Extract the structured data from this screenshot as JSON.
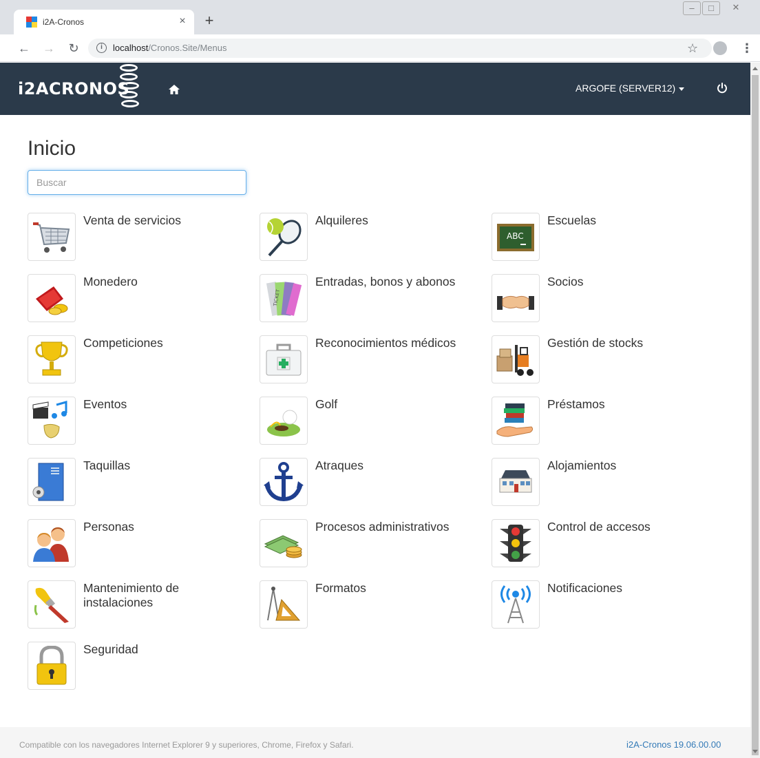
{
  "browser": {
    "tab_title": "i2A-Cronos",
    "tab_close": "×",
    "new_tab": "+",
    "url_host": "localhost",
    "url_path": "/Cronos.Site/Menus"
  },
  "header": {
    "logo_text": "i2ACRONOS",
    "user_label": "ARGOFE (SERVER12)",
    "colors": {
      "header_bg": "#2b3a4a",
      "accent": "#337ab7"
    }
  },
  "page": {
    "title": "Inicio",
    "search_placeholder": "Buscar"
  },
  "menu": [
    {
      "label": "Venta de servicios",
      "icon": "shopping-cart-icon"
    },
    {
      "label": "Alquileres",
      "icon": "tennis-racket-icon"
    },
    {
      "label": "Escuelas",
      "icon": "chalkboard-icon"
    },
    {
      "label": "Monedero",
      "icon": "wallet-icon"
    },
    {
      "label": "Entradas, bonos y abonos",
      "icon": "tickets-icon"
    },
    {
      "label": "Socios",
      "icon": "handshake-icon"
    },
    {
      "label": "Competiciones",
      "icon": "trophy-icon"
    },
    {
      "label": "Reconocimientos médicos",
      "icon": "first-aid-kit-icon"
    },
    {
      "label": "Gestión de stocks",
      "icon": "forklift-icon"
    },
    {
      "label": "Eventos",
      "icon": "events-icon"
    },
    {
      "label": "Golf",
      "icon": "golf-icon"
    },
    {
      "label": "Préstamos",
      "icon": "books-hand-icon"
    },
    {
      "label": "Taquillas",
      "icon": "locker-icon"
    },
    {
      "label": "Atraques",
      "icon": "anchor-icon"
    },
    {
      "label": "Alojamientos",
      "icon": "house-icon"
    },
    {
      "label": "Personas",
      "icon": "people-icon"
    },
    {
      "label": "Procesos administrativos",
      "icon": "money-icon"
    },
    {
      "label": "Control de accesos",
      "icon": "traffic-light-icon"
    },
    {
      "label": "Mantenimiento de instalaciones",
      "icon": "paint-brush-icon"
    },
    {
      "label": "Formatos",
      "icon": "drafting-tools-icon"
    },
    {
      "label": "Notificaciones",
      "icon": "antenna-icon"
    },
    {
      "label": "Seguridad",
      "icon": "padlock-icon"
    }
  ],
  "footer": {
    "compat_text": "Compatible con los navegadores Internet Explorer 9 y superiores, Chrome, Firefox y Safari.",
    "version": "i2A-Cronos 19.06.00.00"
  }
}
